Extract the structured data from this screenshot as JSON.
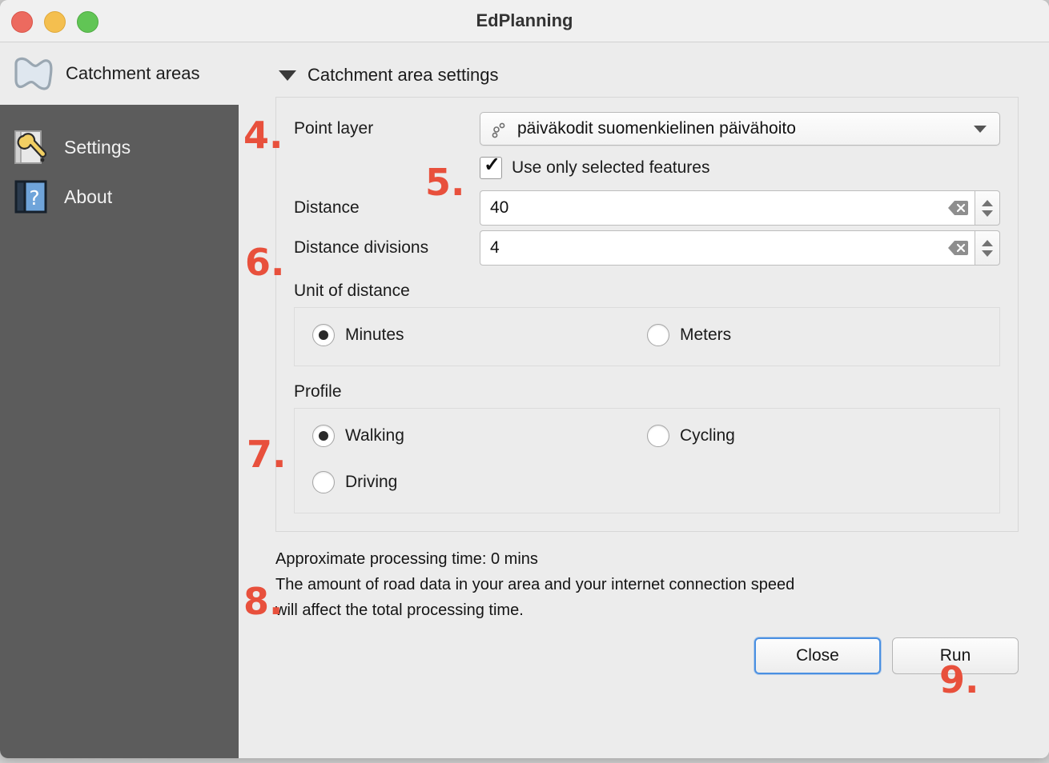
{
  "window": {
    "title": "EdPlanning",
    "traffic_lights": [
      "close-red",
      "minimize-yellow",
      "zoom-green"
    ],
    "colors": {
      "red": "#ec6a5f",
      "yellow": "#f4bf4f",
      "green": "#61c555",
      "annotation_red": "#e8503c",
      "sidebar_bg": "#5c5c5c",
      "window_bg": "#ececec",
      "focus_blue": "#4a90e2"
    }
  },
  "sidebar": {
    "header": {
      "label": "Catchment areas",
      "icon": "catchment-polygon-icon"
    },
    "items": [
      {
        "label": "Settings",
        "icon": "settings-wrench-icon"
      },
      {
        "label": "About",
        "icon": "about-book-icon"
      }
    ]
  },
  "main": {
    "collapse_section": {
      "label": "Catchment area settings",
      "icon": "triangle-down-icon",
      "expanded": true
    },
    "point_layer": {
      "label": "Point layer",
      "value": "päiväkodit suomenkielinen päivähoito",
      "icon": "point-layer-dots-icon",
      "arrow": "chevron-down-icon"
    },
    "use_selected": {
      "label": "Use only selected features",
      "checked": true,
      "mark": "✓"
    },
    "distance": {
      "label": "Distance",
      "value": "40",
      "clear_icon": "backspace-clear-icon"
    },
    "distance_divisions": {
      "label": "Distance divisions",
      "value": "4",
      "clear_icon": "backspace-clear-icon"
    },
    "unit_of_distance": {
      "label": "Unit of distance",
      "options": [
        {
          "label": "Minutes",
          "selected": true
        },
        {
          "label": "Meters",
          "selected": false
        }
      ]
    },
    "profile": {
      "label": "Profile",
      "options": [
        {
          "label": "Walking",
          "selected": true
        },
        {
          "label": "Cycling",
          "selected": false
        },
        {
          "label": "Driving",
          "selected": false
        }
      ]
    },
    "info": {
      "line1": "Approximate processing time: 0 mins",
      "line2": "The amount of road data in your area and your internet connection speed",
      "line3": "will affect the total processing time."
    },
    "buttons": {
      "close": "Close",
      "run": "Run"
    }
  },
  "annotations": [
    {
      "id": "a4",
      "text": "4."
    },
    {
      "id": "a5",
      "text": "5."
    },
    {
      "id": "a6",
      "text": "6."
    },
    {
      "id": "a7",
      "text": "7."
    },
    {
      "id": "a8",
      "text": "8."
    },
    {
      "id": "a9",
      "text": "9."
    }
  ],
  "background_strip": {
    "text_left": "|||||| ||| ||||| || |||| ||||| | |||||||| |||||| |||",
    "text_blue": "||||| ||| |||||||||"
  }
}
